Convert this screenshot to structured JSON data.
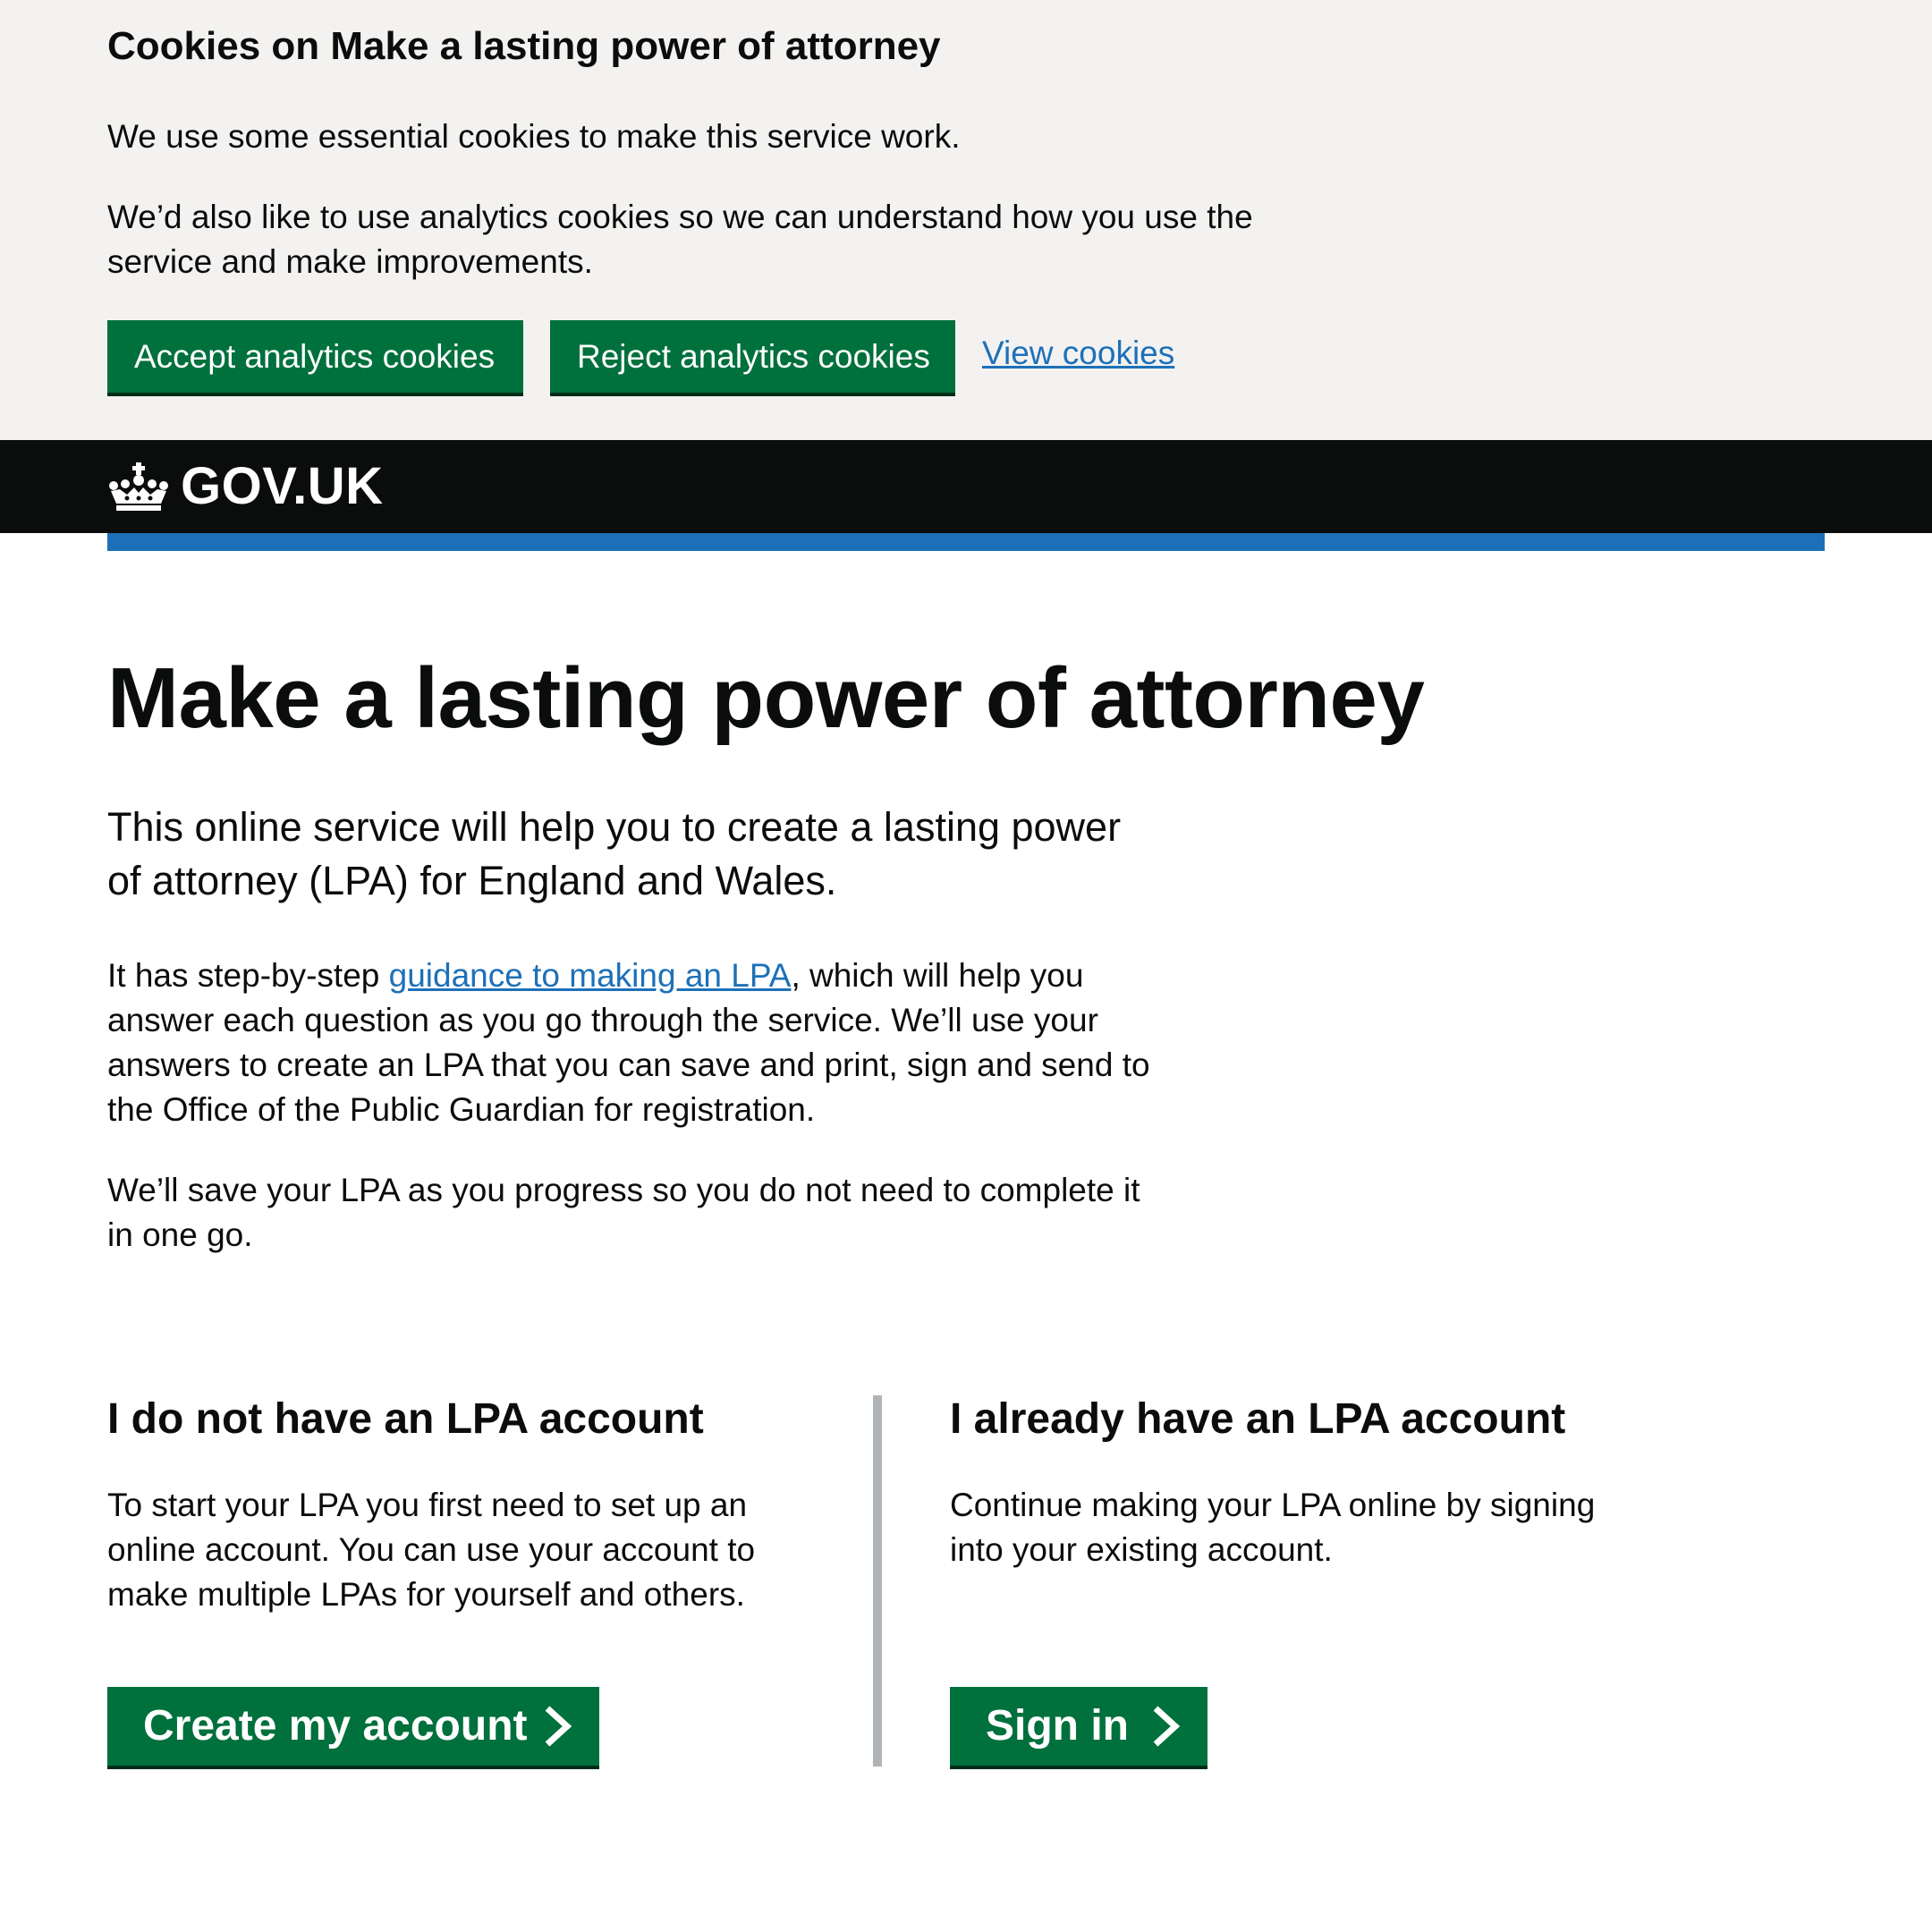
{
  "cookie_banner": {
    "title": "Cookies on Make a lasting power of attorney",
    "paragraph_1": "We use some essential cookies to make this service work.",
    "paragraph_2": "We’d also like to use analytics cookies so we can understand how you use the service and make improvements.",
    "accept_label": "Accept analytics cookies",
    "reject_label": "Reject analytics cookies",
    "view_link": "View cookies"
  },
  "header": {
    "logo_text": "GOV.UK",
    "logo_icon": "crown-icon"
  },
  "main": {
    "title": "Make a lasting power of attorney",
    "lead": "This online service will help you to create a lasting power of attorney (LPA) for England and Wales.",
    "body_1_before": "It has step-by-step ",
    "body_1_link": "guidance to making an LPA",
    "body_1_after": ", which will help you answer each question as you go through the service. We’ll use your answers to create an LPA that you can save and print, sign and send to the Office of the Public Guardian for registration.",
    "body_2": "We’ll save your LPA as you progress so you do not need to complete it in one go."
  },
  "no_account": {
    "heading": "I do not have an LPA account",
    "text": "To start your LPA you first need to set up an online account. You can use your account to make multiple LPAs for yourself and others.",
    "button_label": "Create my account"
  },
  "has_account": {
    "heading": "I already have an LPA account",
    "text": "Continue making your LPA online by signing into your existing account.",
    "button_label": "Sign in"
  },
  "colors": {
    "banner_bg": "#f3f2f1",
    "button_green": "#00703c",
    "link_blue": "#1d70b8",
    "header_black": "#0b0c0c",
    "divider_grey": "#b1b4b6"
  }
}
